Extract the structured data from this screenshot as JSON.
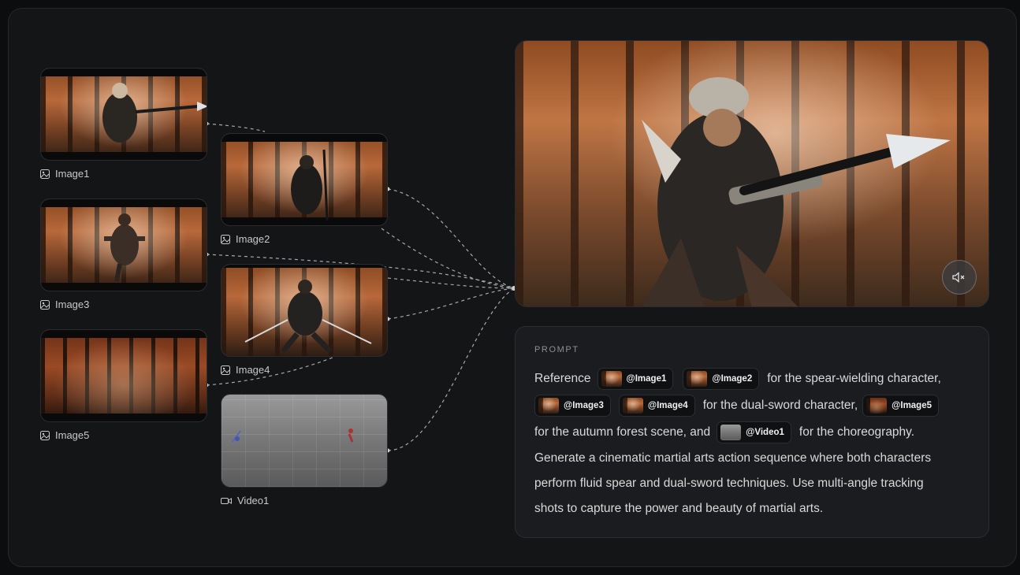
{
  "inputs": [
    {
      "label": "Image1",
      "type": "image"
    },
    {
      "label": "Image2",
      "type": "image"
    },
    {
      "label": "Image3",
      "type": "image"
    },
    {
      "label": "Image4",
      "type": "image"
    },
    {
      "label": "Image5",
      "type": "image"
    },
    {
      "label": "Video1",
      "type": "video"
    }
  ],
  "prompt": {
    "heading": "PROMPT",
    "line1": {
      "t1": "Reference",
      "c1": "@Image1",
      "c2": "@Image2",
      "t2": "for the spear-wielding character,"
    },
    "line2": {
      "c1": "@Image3",
      "c2": "@Image4",
      "t1": "for the dual-sword character,",
      "c3": "@Image5"
    },
    "line3": {
      "t1": "for the autumn forest scene, and",
      "c1": "@Video1",
      "t2": "for the choreography."
    },
    "line4": "Generate a cinematic martial arts action sequence where both characters",
    "line5": "perform fluid spear and dual-sword techniques. Use multi-angle tracking",
    "line6": "shots to capture the power and beauty of martial arts."
  },
  "output": {
    "mute_icon": "speaker-muted-icon"
  },
  "colors": {
    "background": "#141517",
    "card": "#1b1c1f",
    "chip": "#0f1012",
    "text": "#d9d9d9"
  }
}
